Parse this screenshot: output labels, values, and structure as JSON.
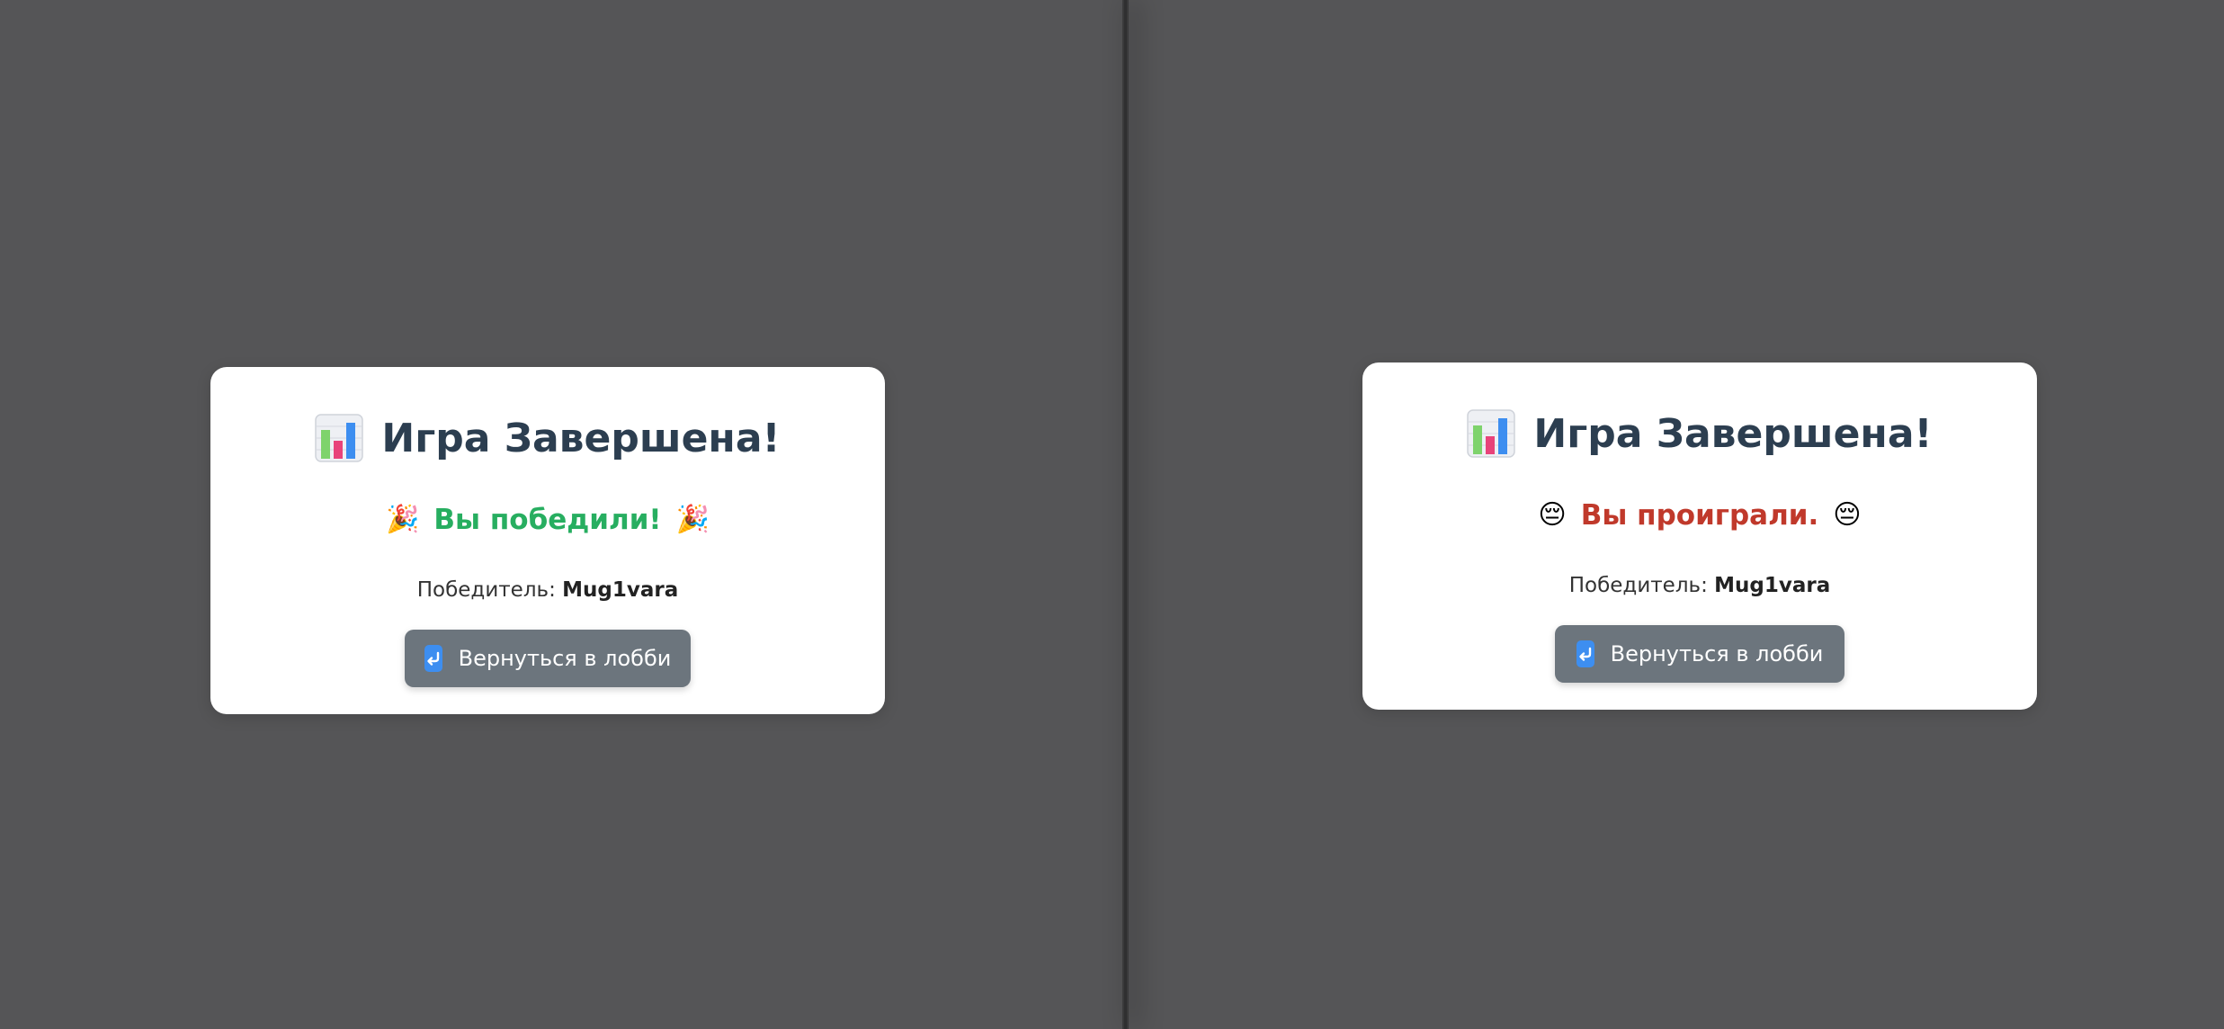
{
  "panels": [
    {
      "title_icon": "bar-chart-icon",
      "title": "Игра Завершена!",
      "result": {
        "emoji": "🎉",
        "emoji_name": "party-popper-icon",
        "text": "Вы победили!",
        "color": "#27ae60"
      },
      "winner_label": "Победитель:",
      "winner_name": "Mug1vara",
      "button": {
        "icon": "return-arrow-icon",
        "label": "Вернуться в лобби"
      }
    },
    {
      "title_icon": "bar-chart-icon",
      "title": "Игра Завершена!",
      "result": {
        "emoji": "😔",
        "emoji_name": "pensive-face-icon",
        "text": "Вы проиграли.",
        "color": "#c0392b"
      },
      "winner_label": "Победитель:",
      "winner_name": "Mug1vara",
      "button": {
        "icon": "return-arrow-icon",
        "label": "Вернуться в лобби"
      }
    }
  ],
  "colors": {
    "background": "#555557",
    "card": "#ffffff",
    "title": "#2c3e50",
    "button": "#6c757d",
    "button_icon": "#3d8ef0"
  }
}
